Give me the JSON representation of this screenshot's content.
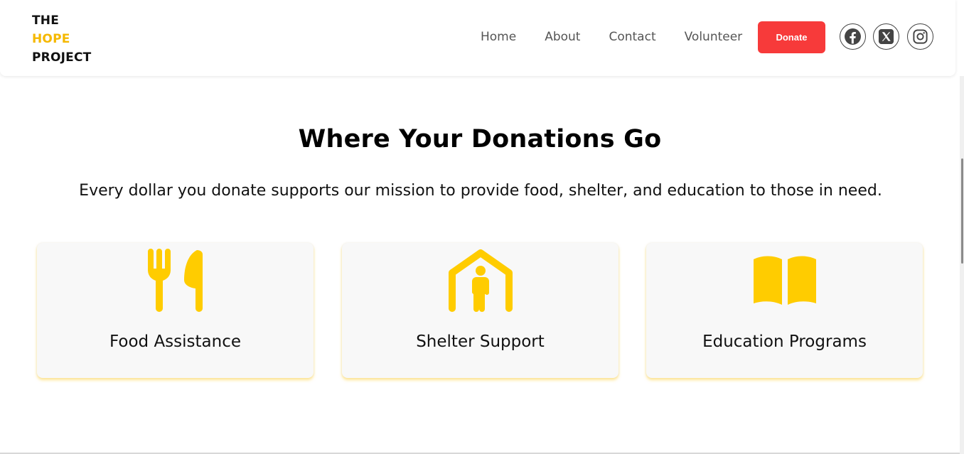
{
  "brand": {
    "line1": "THE",
    "line2": "HOPE",
    "line3": "PROJECT",
    "accent_color": "#f5b800"
  },
  "nav": {
    "items": [
      {
        "label": "Home"
      },
      {
        "label": "About"
      },
      {
        "label": "Contact"
      },
      {
        "label": "Volunteer"
      }
    ],
    "donate_label": "Donate",
    "donate_color": "#f73a3a"
  },
  "social": [
    {
      "icon": "facebook-icon"
    },
    {
      "icon": "x-icon"
    },
    {
      "icon": "instagram-icon"
    }
  ],
  "main": {
    "title": "Where Your Donations Go",
    "subtitle": "Every dollar you donate supports our mission to provide food, shelter, and education to those in need.",
    "cards": [
      {
        "icon": "fork-knife-icon",
        "label": "Food Assistance"
      },
      {
        "icon": "house-person-icon",
        "label": "Shelter Support"
      },
      {
        "icon": "open-book-icon",
        "label": "Education Programs"
      }
    ],
    "icon_color": "#ffcc00"
  }
}
